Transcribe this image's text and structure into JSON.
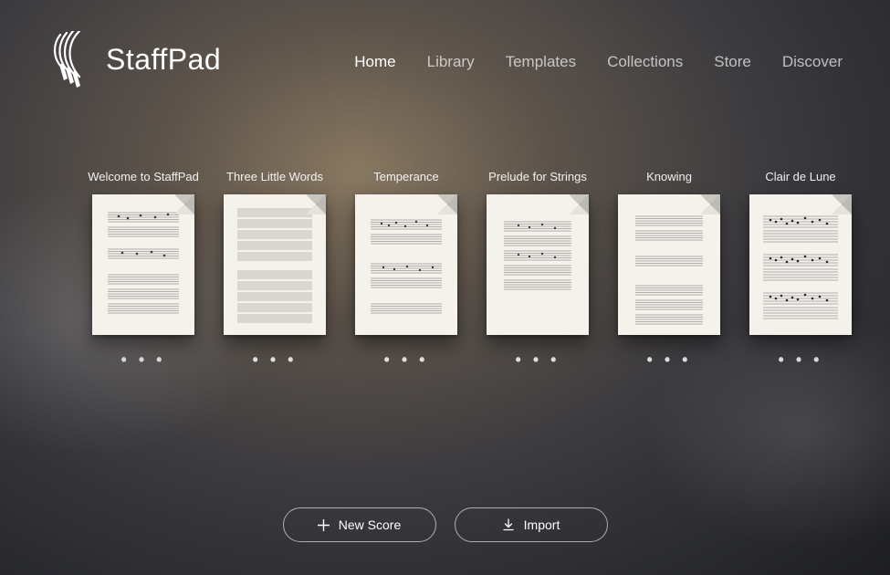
{
  "brand": {
    "name": "StaffPad"
  },
  "nav": {
    "items": [
      {
        "label": "Home",
        "active": true
      },
      {
        "label": "Library",
        "active": false
      },
      {
        "label": "Templates",
        "active": false
      },
      {
        "label": "Collections",
        "active": false
      },
      {
        "label": "Store",
        "active": false
      },
      {
        "label": "Discover",
        "active": false
      }
    ]
  },
  "scores": [
    {
      "title": "Welcome to StaffPad"
    },
    {
      "title": "Three Little Words"
    },
    {
      "title": "Temperance"
    },
    {
      "title": "Prelude for Strings"
    },
    {
      "title": "Knowing"
    },
    {
      "title": "Clair de Lune"
    }
  ],
  "actions": {
    "new_score": "New Score",
    "import": "Import"
  },
  "icons": {
    "more": "• • •"
  }
}
